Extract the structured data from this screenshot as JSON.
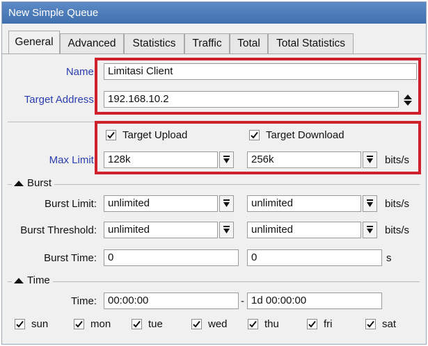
{
  "window": {
    "title": "New Simple Queue"
  },
  "tabs": [
    "General",
    "Advanced",
    "Statistics",
    "Traffic",
    "Total",
    "Total Statistics"
  ],
  "general": {
    "name_label": "Name:",
    "name_value": "Limitasi Client",
    "target_address_label": "Target Address:",
    "target_address_value": "192.168.10.2",
    "target_upload_label": "Target Upload",
    "target_download_label": "Target Download",
    "max_limit_label": "Max Limit:",
    "max_limit_upload": "128k",
    "max_limit_download": "256k",
    "unit": "bits/s"
  },
  "burst": {
    "section_label": "Burst",
    "limit_label": "Burst Limit:",
    "limit_upload": "unlimited",
    "limit_download": "unlimited",
    "threshold_label": "Burst Threshold:",
    "threshold_upload": "unlimited",
    "threshold_download": "unlimited",
    "time_label": "Burst Time:",
    "time_upload": "0",
    "time_download": "0",
    "time_unit": "s"
  },
  "time": {
    "section_label": "Time",
    "label": "Time:",
    "start": "00:00:00",
    "dash": "-",
    "end": "1d 00:00:00",
    "days": [
      "sun",
      "mon",
      "tue",
      "wed",
      "thu",
      "fri",
      "sat"
    ]
  },
  "colors": {
    "highlight_box": "#d0202e",
    "label_blue": "#2a3dae",
    "title_bar": "#4a7bbb"
  }
}
